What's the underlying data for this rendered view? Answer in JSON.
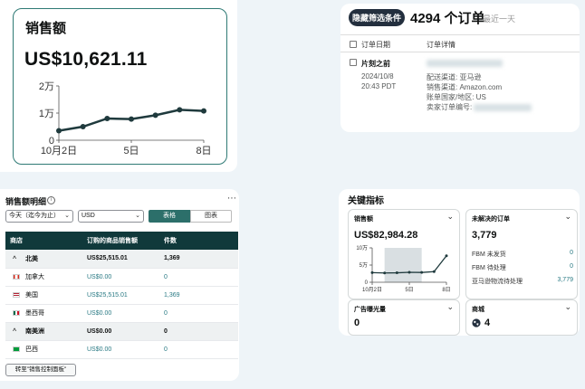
{
  "sales_card": {
    "title": "销售额",
    "value": "US$10,621.11",
    "chart_data": {
      "type": "line",
      "x_tick_labels": [
        "10月2日",
        "5日",
        "8日"
      ],
      "y_tick_labels": [
        "0",
        "1万",
        "2万"
      ],
      "x": [
        2,
        3,
        4,
        5,
        6,
        7,
        8
      ],
      "values": [
        3500,
        5000,
        8000,
        7800,
        9200,
        11200,
        10800
      ],
      "ylim": [
        0,
        20000
      ],
      "line_color": "#1f3a3d"
    }
  },
  "orders": {
    "filter_button": "隐藏筛选条件",
    "count": "4294 个订单",
    "period": "最近一天",
    "header_date": "订单日期",
    "header_detail": "订单详情",
    "row": {
      "when": "片刻之前",
      "date": "2024/10/8",
      "time": "20:43 PDT",
      "fulfillment": "配送渠道: 亚马逊",
      "channel": "销售渠道: Amazon.com",
      "ship_country": "账单国家/地区: US",
      "seller_order": "卖家订单编号:"
    }
  },
  "breakdown": {
    "title": "销售额明细",
    "date_select": "今天（迄今为止）",
    "currency_select": "USD",
    "view_table": "表格",
    "view_chart": "图表",
    "columns": [
      "商店",
      "订购的商品销售额",
      "件数"
    ],
    "rows": [
      {
        "name": "北美",
        "sales": "US$25,515.01",
        "units": "1,369",
        "group": true
      },
      {
        "name": "加拿大",
        "sales": "US$0.00",
        "units": "0",
        "group": false,
        "flag": "ca"
      },
      {
        "name": "美国",
        "sales": "US$25,515.01",
        "units": "1,369",
        "group": false,
        "flag": "us"
      },
      {
        "name": "墨西哥",
        "sales": "US$0.00",
        "units": "0",
        "group": false,
        "flag": "mx"
      },
      {
        "name": "南美洲",
        "sales": "US$0.00",
        "units": "0",
        "group": true
      },
      {
        "name": "巴西",
        "sales": "US$0.00",
        "units": "0",
        "group": false,
        "flag": "br"
      }
    ],
    "goto_button": "转至\"销售控制面板\""
  },
  "key_metrics": {
    "title": "关键指标",
    "sales": {
      "label": "销售额",
      "value": "US$82,984.28",
      "chart_data": {
        "type": "line",
        "x_tick_labels": [
          "10月2日",
          "5日",
          "8日"
        ],
        "y_tick_labels": [
          "0",
          "5万",
          "10万"
        ],
        "x": [
          2,
          3,
          4,
          5,
          6,
          7,
          8
        ],
        "values": [
          28000,
          27000,
          27500,
          29000,
          28500,
          31000,
          77000
        ],
        "ylim": [
          0,
          100000
        ],
        "line_color": "#1f3a3d",
        "highlight_band_color": "#d9dfe2"
      }
    },
    "unfulfilled": {
      "label": "未解决的订单",
      "value": "3,779",
      "rows": [
        {
          "label": "FBM 未发货",
          "value": "0"
        },
        {
          "label": "FBM 待处理",
          "value": "0"
        },
        {
          "label": "亚马逊物流待处理",
          "value": "3,779"
        }
      ]
    },
    "ads": {
      "label": "广告曝光量",
      "value": "0"
    },
    "markets": {
      "label": "商城",
      "value": "4"
    }
  }
}
